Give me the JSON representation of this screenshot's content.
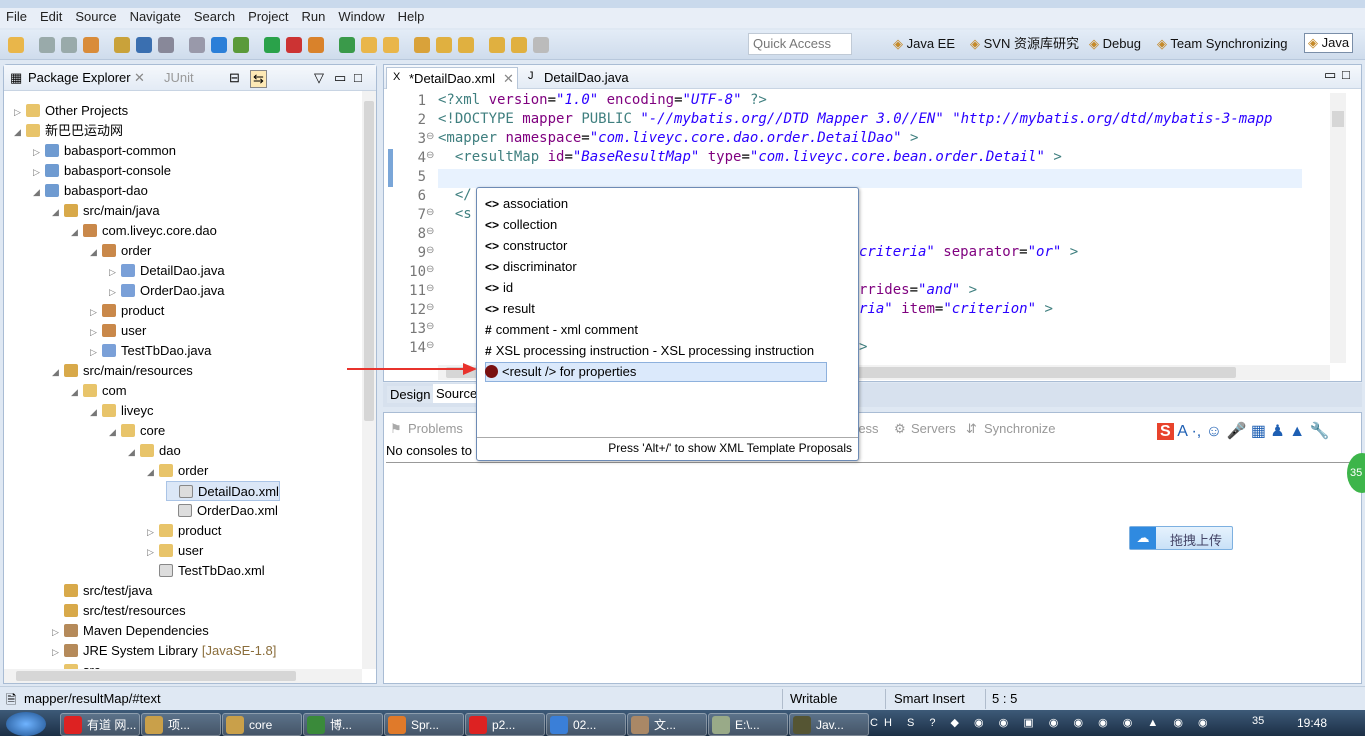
{
  "menu": [
    "File",
    "Edit",
    "Source",
    "Navigate",
    "Search",
    "Project",
    "Run",
    "Window",
    "Help"
  ],
  "toolbar": {
    "quick_access_placeholder": "Quick Access"
  },
  "perspectives": [
    {
      "label": "Java EE"
    },
    {
      "label": "SVN 资源库研究"
    },
    {
      "label": "Debug"
    },
    {
      "label": "Team Synchronizing"
    },
    {
      "label": "Java",
      "active": true
    }
  ],
  "explorer": {
    "tabs": [
      "Package Explorer",
      "JUnit"
    ],
    "tree": [
      {
        "label": "Other Projects",
        "level": 0,
        "arrow": "collapsed",
        "icon": "folder"
      },
      {
        "label": "新巴巴运动网",
        "level": 0,
        "arrow": "expanded",
        "icon": "folder"
      },
      {
        "label": "babasport-common",
        "level": 1,
        "arrow": "collapsed",
        "icon": "project"
      },
      {
        "label": "babasport-console",
        "level": 1,
        "arrow": "collapsed",
        "icon": "project"
      },
      {
        "label": "babasport-dao",
        "level": 1,
        "arrow": "expanded",
        "icon": "project"
      },
      {
        "label": "src/main/java",
        "level": 2,
        "arrow": "expanded",
        "icon": "srcfolder"
      },
      {
        "label": "com.liveyc.core.dao",
        "level": 3,
        "arrow": "expanded",
        "icon": "package"
      },
      {
        "label": "order",
        "level": 4,
        "arrow": "expanded",
        "icon": "package"
      },
      {
        "label": "DetailDao.java",
        "level": 5,
        "arrow": "collapsed",
        "icon": "java"
      },
      {
        "label": "OrderDao.java",
        "level": 5,
        "arrow": "collapsed",
        "icon": "java"
      },
      {
        "label": "product",
        "level": 4,
        "arrow": "collapsed",
        "icon": "package"
      },
      {
        "label": "user",
        "level": 4,
        "arrow": "collapsed",
        "icon": "package"
      },
      {
        "label": "TestTbDao.java",
        "level": 4,
        "arrow": "collapsed",
        "icon": "java"
      },
      {
        "label": "src/main/resources",
        "level": 2,
        "arrow": "expanded",
        "icon": "srcfolder"
      },
      {
        "label": "com",
        "level": 3,
        "arrow": "expanded",
        "icon": "folder"
      },
      {
        "label": "liveyc",
        "level": 4,
        "arrow": "expanded",
        "icon": "folder"
      },
      {
        "label": "core",
        "level": 5,
        "arrow": "expanded",
        "icon": "folder"
      },
      {
        "label": "dao",
        "level": 6,
        "arrow": "expanded",
        "icon": "folder"
      },
      {
        "label": "order",
        "level": 7,
        "arrow": "expanded",
        "icon": "folder"
      },
      {
        "label": "DetailDao.xml",
        "level": 8,
        "arrow": "none",
        "icon": "xml",
        "selected": true
      },
      {
        "label": "OrderDao.xml",
        "level": 8,
        "arrow": "none",
        "icon": "xml"
      },
      {
        "label": "product",
        "level": 7,
        "arrow": "collapsed",
        "icon": "folder"
      },
      {
        "label": "user",
        "level": 7,
        "arrow": "collapsed",
        "icon": "folder"
      },
      {
        "label": "TestTbDao.xml",
        "level": 7,
        "arrow": "none",
        "icon": "xml"
      },
      {
        "label": "src/test/java",
        "level": 2,
        "arrow": "none",
        "icon": "srcfolder"
      },
      {
        "label": "src/test/resources",
        "level": 2,
        "arrow": "none",
        "icon": "srcfolder"
      },
      {
        "label": "Maven Dependencies",
        "level": 2,
        "arrow": "collapsed",
        "icon": "library"
      },
      {
        "label": "JRE System Library",
        "suffix": "[JavaSE-1.8]",
        "level": 2,
        "arrow": "collapsed",
        "icon": "library"
      },
      {
        "label": "src",
        "level": 2,
        "arrow": "collapsed",
        "icon": "folder"
      }
    ]
  },
  "editor": {
    "tabs": [
      {
        "label": "*DetailDao.xml",
        "active": true
      },
      {
        "label": "DetailDao.java"
      }
    ],
    "lines": [
      {
        "n": "1",
        "tokens": [
          [
            "<?xml ",
            "tag"
          ],
          [
            "version",
            "attr"
          ],
          [
            "=",
            "plain"
          ],
          [
            "\"1.0\"",
            "str"
          ],
          [
            " ",
            "plain"
          ],
          [
            "encoding",
            "attr"
          ],
          [
            "=",
            "plain"
          ],
          [
            "\"UTF-8\"",
            "str"
          ],
          [
            " ?>",
            "tag"
          ]
        ]
      },
      {
        "n": "2",
        "tokens": [
          [
            "<!DOCTYPE ",
            "doc"
          ],
          [
            "mapper ",
            "attr"
          ],
          [
            "PUBLIC ",
            "doc"
          ],
          [
            "\"-//mybatis.org//DTD Mapper 3.0//EN\" \"http://mybatis.org/dtd/mybatis-3-mapp",
            "str"
          ]
        ]
      },
      {
        "n": "3",
        "fold": true,
        "tokens": [
          [
            "<mapper ",
            "tag"
          ],
          [
            "namespace",
            "attr"
          ],
          [
            "=",
            "plain"
          ],
          [
            "\"com.liveyc.core.dao.order.DetailDao\"",
            "str"
          ],
          [
            " >",
            "tag"
          ]
        ]
      },
      {
        "n": "4",
        "fold": true,
        "tokens": [
          [
            "  <resultMap ",
            "tag"
          ],
          [
            "id",
            "attr"
          ],
          [
            "=",
            "plain"
          ],
          [
            "\"BaseResultMap\"",
            "str"
          ],
          [
            " ",
            "plain"
          ],
          [
            "type",
            "attr"
          ],
          [
            "=",
            "plain"
          ],
          [
            "\"com.liveyc.core.bean.order.Detail\"",
            "str"
          ],
          [
            " >",
            "tag"
          ]
        ]
      },
      {
        "n": "5",
        "tokens": []
      },
      {
        "n": "6",
        "tokens": [
          [
            "  </",
            "tag"
          ]
        ]
      },
      {
        "n": "7",
        "fold": true,
        "tokens": [
          [
            "  <s",
            "tag"
          ]
        ]
      },
      {
        "n": "8",
        "fold": true,
        "tokens": []
      },
      {
        "n": "9",
        "fold": true,
        "tail": [
          [
            "criteria\"",
            "str"
          ],
          [
            " ",
            "plain"
          ],
          [
            "separator",
            "attr"
          ],
          [
            "=",
            "plain"
          ],
          [
            "\"or\"",
            "str"
          ],
          [
            " >",
            "tag"
          ]
        ]
      },
      {
        "n": "10",
        "fold": true,
        "tail": []
      },
      {
        "n": "11",
        "fold": true,
        "tail": [
          [
            "rrides",
            "attr"
          ],
          [
            "=",
            "plain"
          ],
          [
            "\"and\"",
            "str"
          ],
          [
            " >",
            "tag"
          ]
        ]
      },
      {
        "n": "12",
        "fold": true,
        "tail": [
          [
            "ria\"",
            "str"
          ],
          [
            " ",
            "plain"
          ],
          [
            "item",
            "attr"
          ],
          [
            "=",
            "plain"
          ],
          [
            "\"criterion\"",
            "str"
          ],
          [
            " >",
            "tag"
          ]
        ]
      },
      {
        "n": "13",
        "fold": true,
        "tail": []
      },
      {
        "n": "14",
        "fold": true,
        "tail": [
          [
            ">",
            "tag"
          ]
        ]
      }
    ],
    "bottom_tabs": [
      "Design",
      "Source"
    ]
  },
  "content_assist": {
    "items": [
      {
        "icon": "<>",
        "label": "association"
      },
      {
        "icon": "<>",
        "label": "collection"
      },
      {
        "icon": "<>",
        "label": "constructor"
      },
      {
        "icon": "<>",
        "label": "discriminator"
      },
      {
        "icon": "<>",
        "label": "id"
      },
      {
        "icon": "<>",
        "label": "result"
      },
      {
        "icon": "#",
        "label": "comment - xml comment"
      },
      {
        "icon": "#",
        "label": "XSL processing instruction - XSL processing instruction"
      },
      {
        "icon": "template",
        "label": "<result /> for properties",
        "selected": true
      }
    ],
    "footer": "Press 'Alt+/' to show XML Template Proposals"
  },
  "console": {
    "tabs": [
      "Problems",
      "ress",
      "Servers",
      "Synchronize"
    ],
    "message": "No consoles to",
    "upload_button": "拖拽上传",
    "badge": "35"
  },
  "status": {
    "path": "mapper/resultMap/#text",
    "writable": "Writable",
    "insert_mode": "Smart Insert",
    "position": "5 : 5"
  },
  "taskbar": {
    "items": [
      "有道 网...",
      "项...",
      "core",
      "博...",
      "Spr...",
      "p2...",
      "02...",
      "文...",
      "E:\\...",
      "Jav..."
    ],
    "time": "19:48",
    "tray_badge": "35"
  },
  "colors": {
    "accent": "#3f7f7f",
    "attr": "#7f007f",
    "string": "#2a00ff",
    "arrow": "#e8322c"
  }
}
